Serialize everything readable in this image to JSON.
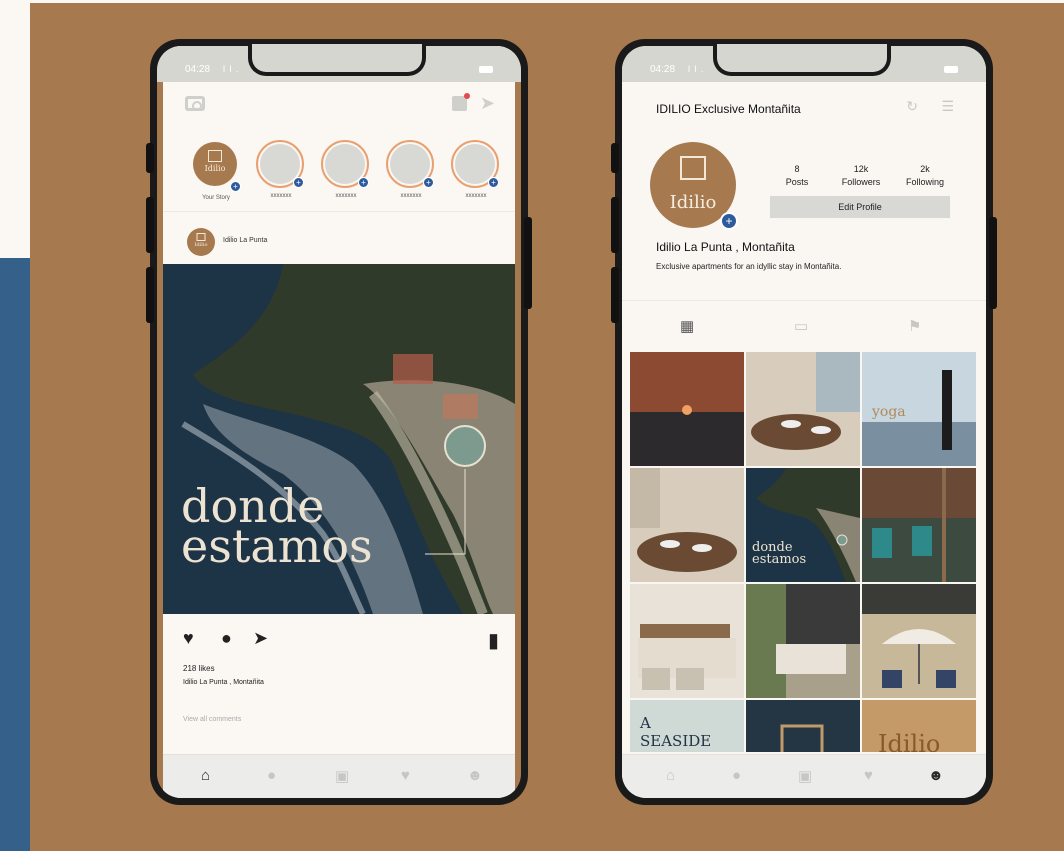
{
  "colors": {
    "brand": "#a67a4e",
    "accent": "#2e5b9c",
    "frame": "#1a1a1a"
  },
  "left_phone": {
    "status": {
      "time": "04:28",
      "signal": "l l ."
    },
    "stories": [
      {
        "label": "Your Story"
      },
      {
        "label": "xxxxxxx"
      },
      {
        "label": "xxxxxxx"
      },
      {
        "label": "xxxxxxx"
      },
      {
        "label": "xxxxxxx"
      }
    ],
    "logo_text": "Idilio",
    "post": {
      "account": "Idilio La Punta",
      "image_text_line1": "donde",
      "image_text_line2": "estamos",
      "likes": "218 likes",
      "caption": "Idilio La Punta , Montañita",
      "comments": "View all comments"
    },
    "icons": {
      "top": [
        "camera-icon",
        "igtv-icon",
        "send-icon"
      ],
      "actions": [
        "heart-icon",
        "comment-icon",
        "share-icon",
        "bookmark-icon"
      ],
      "nav": [
        "home-icon",
        "search-icon",
        "add-icon",
        "heart-icon",
        "profile-icon"
      ]
    }
  },
  "right_phone": {
    "status": {
      "time": "04:28",
      "signal": "l l ."
    },
    "title": "IDILIO Exclusive Montañita",
    "logo_text": "Idilio",
    "stats": [
      {
        "value": "8",
        "label": "Posts"
      },
      {
        "value": "12k",
        "label": "Followers"
      },
      {
        "value": "2k",
        "label": "Following"
      }
    ],
    "edit_profile": "Edit Profile",
    "bio_name": "Idilio La Punta , Montañita",
    "bio_text": "Exclusive apartments for an idyllic stay in Montañita.",
    "tabs": [
      "grid-icon",
      "tv-icon",
      "tagged-icon"
    ],
    "grid_text": {
      "yoga": "yoga",
      "donde": "donde",
      "estamos": "estamos",
      "a": "A",
      "seaside": "SEASIDE",
      "idilio": "Idilio"
    }
  }
}
